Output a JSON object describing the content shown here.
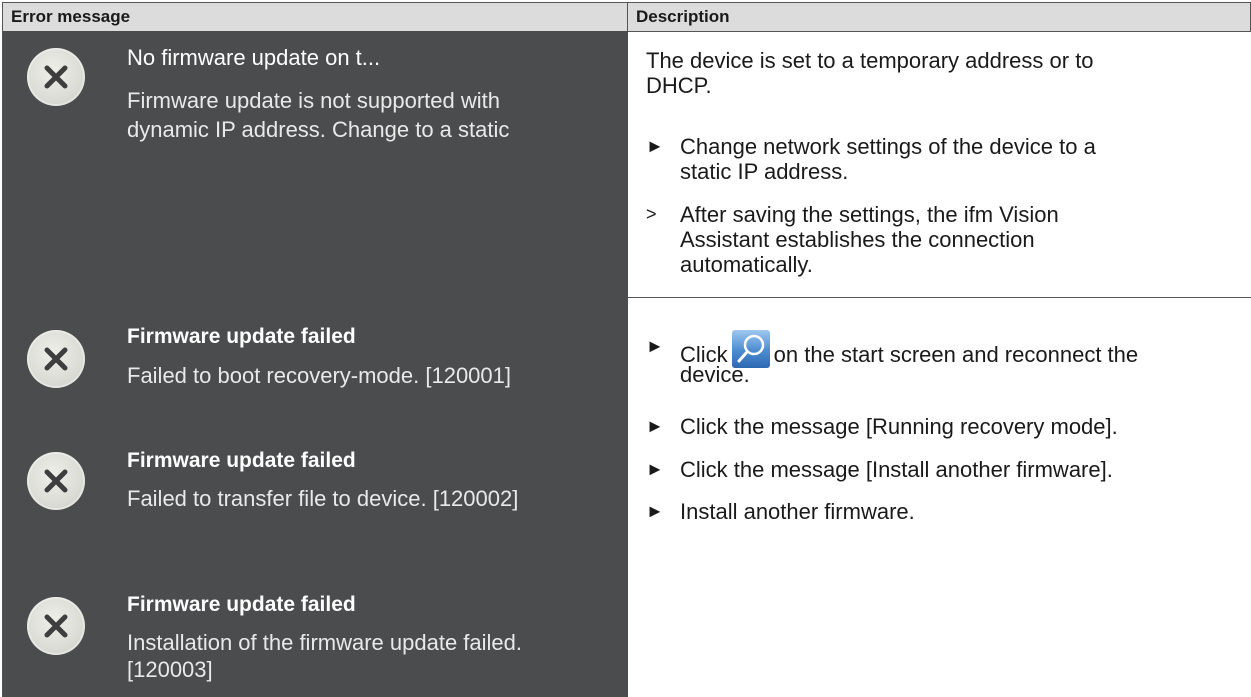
{
  "header": {
    "col1": "Error message",
    "col2": "Description"
  },
  "messages": [
    {
      "title": "No firmware update on t...",
      "body_line1": "Firmware update is not supported with",
      "body_line2": "dynamic IP address. Change to a static",
      "icon": "error-x-icon"
    },
    {
      "title": "Firmware update failed",
      "body_line1": "Failed to boot recovery-mode. [120001]",
      "icon": "error-x-icon"
    },
    {
      "title": "Firmware update failed",
      "body_line1": "Failed to transfer file to device. [120002]",
      "icon": "error-x-icon"
    },
    {
      "title": "Firmware update failed",
      "body_line1": "Installation of the firmware update failed.",
      "body_line2": "[120003]",
      "icon": "error-x-icon"
    }
  ],
  "description1": {
    "para_line1": "The device is set to a temporary address or to",
    "para_line2": "DHCP.",
    "step1_line1": "Change network settings of the device to a",
    "step1_line2": "static IP address.",
    "result_line1": "After saving the settings, the ifm Vision",
    "result_line2": "Assistant establishes the connection",
    "result_line3": "automatically.",
    "bullet": "►",
    "result_marker": ">"
  },
  "description2": {
    "step1_pre": "Click",
    "step1_post": "on the start screen and reconnect the",
    "step1_line2": "device.",
    "step2": "Click the message [Running recovery mode].",
    "step3": "Click the message [Install another firmware].",
    "step4": "Install another firmware.",
    "bullet": "►",
    "icon": "magnifier-icon"
  },
  "colors": {
    "header_bg": "#dcdcdc",
    "dark_panel": "#4a4c4d",
    "text_dark": "#1a1a1a"
  }
}
